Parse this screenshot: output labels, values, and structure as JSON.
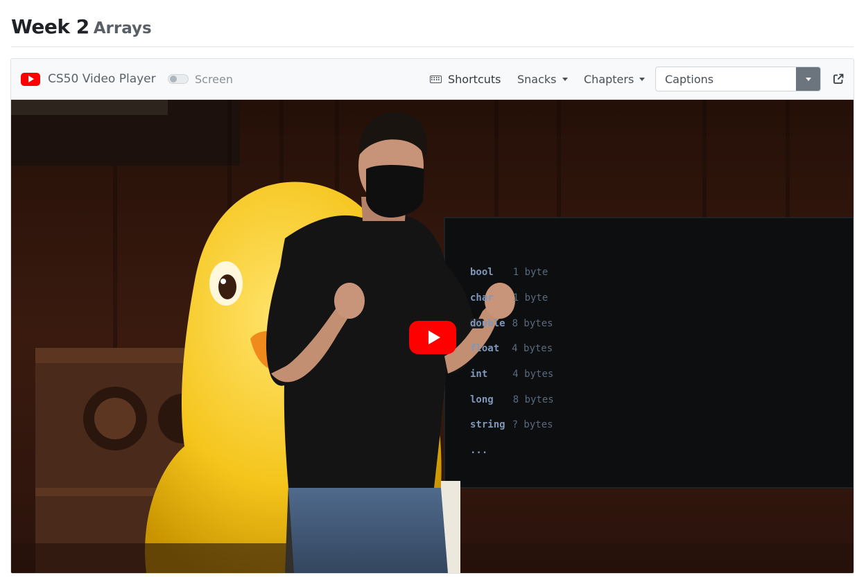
{
  "header": {
    "week": "Week 2",
    "topic": "Arrays"
  },
  "player": {
    "title": "CS50 Video Player",
    "screen_toggle": {
      "label": "Screen",
      "on": false
    },
    "shortcuts_label": "Shortcuts",
    "snacks_label": "Snacks",
    "chapters_label": "Chapters",
    "captions": {
      "placeholder": "Captions",
      "value": ""
    },
    "icons": {
      "brand": "youtube-icon",
      "shortcuts": "keyboard-icon",
      "external": "external-link-icon",
      "play": "play-icon"
    },
    "colors": {
      "youtube_red": "#ff0000",
      "toolbar_bg": "#f8f9fa",
      "dropdown_toggle": "#6c757d"
    }
  },
  "video": {
    "board_lines": [
      {
        "type": "bool",
        "size": "1 byte"
      },
      {
        "type": "char",
        "size": "1 byte"
      },
      {
        "type": "double",
        "size": "8 bytes"
      },
      {
        "type": "float",
        "size": "4 bytes"
      },
      {
        "type": "int",
        "size": "4 bytes"
      },
      {
        "type": "long",
        "size": "8 bytes"
      },
      {
        "type": "string",
        "size": "? bytes"
      },
      {
        "type": "...",
        "size": ""
      }
    ]
  }
}
